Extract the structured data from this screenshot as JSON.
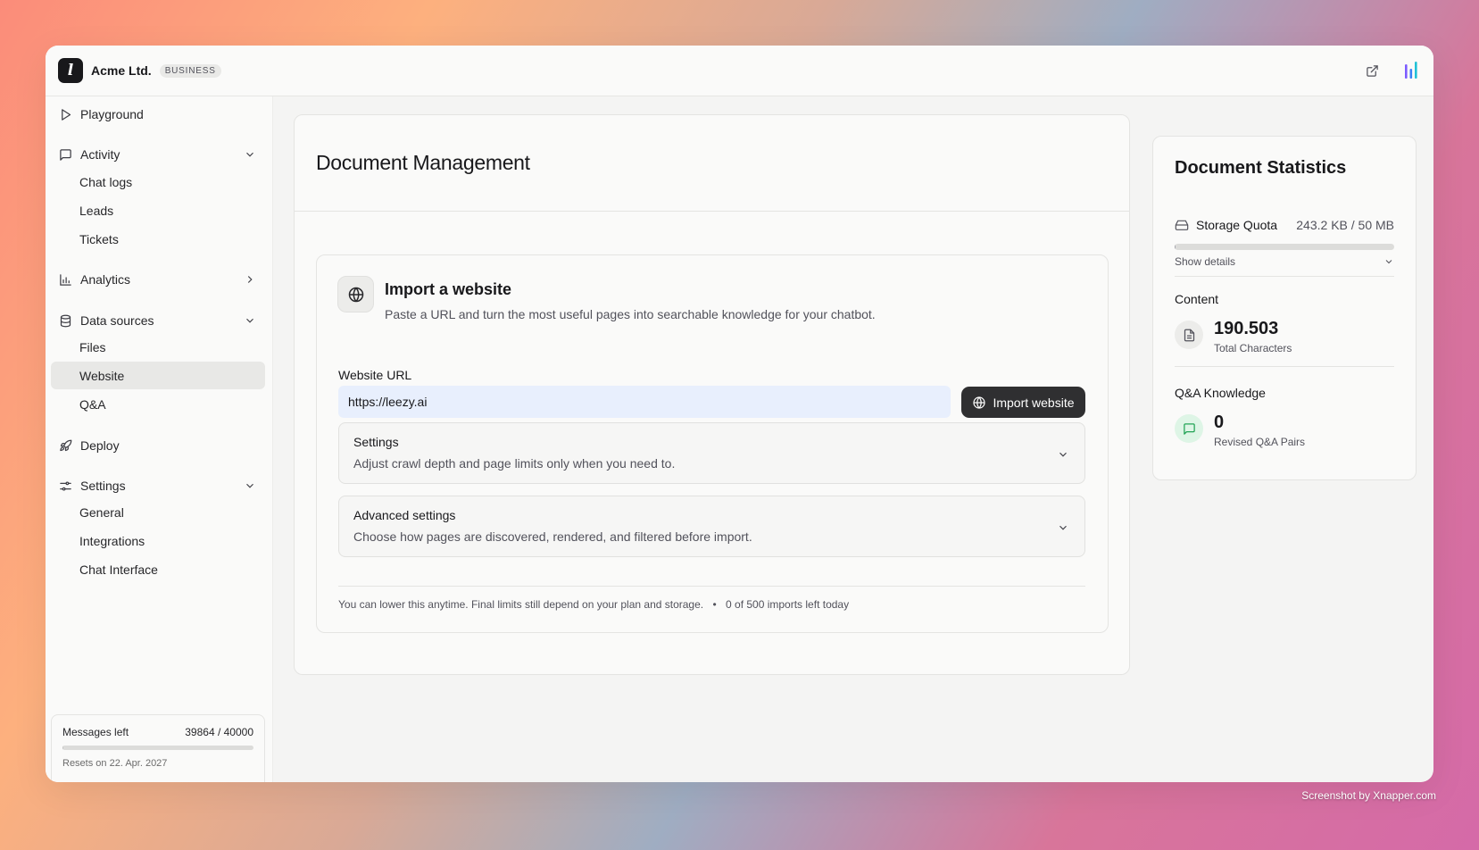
{
  "header": {
    "logo_letter": "l",
    "org_name": "Acme Ltd.",
    "plan": "BUSINESS"
  },
  "sidebar": {
    "playground": "Playground",
    "activity": {
      "label": "Activity",
      "items": [
        "Chat logs",
        "Leads",
        "Tickets"
      ]
    },
    "analytics": "Analytics",
    "data_sources": {
      "label": "Data sources",
      "items": [
        "Files",
        "Website",
        "Q&A"
      ],
      "active": "Website"
    },
    "deploy": "Deploy",
    "settings": {
      "label": "Settings",
      "items": [
        "General",
        "Integrations",
        "Chat Interface"
      ]
    },
    "messages": {
      "label": "Messages left",
      "value": "39864 / 40000",
      "used_fraction": 0.0034,
      "reset": "Resets on 22. Apr. 2027"
    }
  },
  "main": {
    "title": "Document Management",
    "import": {
      "title": "Import a website",
      "description": "Paste a URL and turn the most useful pages into searchable knowledge for your chatbot.",
      "url_label": "Website URL",
      "url_value": "https://leezy.ai",
      "button": "Import website",
      "settings": {
        "title": "Settings",
        "description": "Adjust crawl depth and page limits only when you need to."
      },
      "advanced": {
        "title": "Advanced settings",
        "description": "Choose how pages are discovered, rendered, and filtered before import."
      },
      "footer_note": "You can lower this anytime. Final limits still depend on your plan and storage.",
      "footer_sep": "•",
      "imports_left": "0 of 500 imports left today"
    }
  },
  "stats": {
    "title": "Document Statistics",
    "storage": {
      "label": "Storage Quota",
      "value": "243.2 KB / 50 MB",
      "used_fraction": 0.005,
      "show_details": "Show details"
    },
    "content": {
      "label": "Content",
      "value": "190.503",
      "sub": "Total Characters"
    },
    "qa": {
      "label": "Q&A Knowledge",
      "value": "0",
      "sub": "Revised Q&A Pairs"
    }
  },
  "credit": "Screenshot by Xnapper.com",
  "colors": {
    "accent_dark": "#2f2f31",
    "input_bg": "#e8effd",
    "qa_icon": "#22a355",
    "brand_bars": [
      "#7c5cff",
      "#3b82f6",
      "#22c1d6"
    ]
  }
}
